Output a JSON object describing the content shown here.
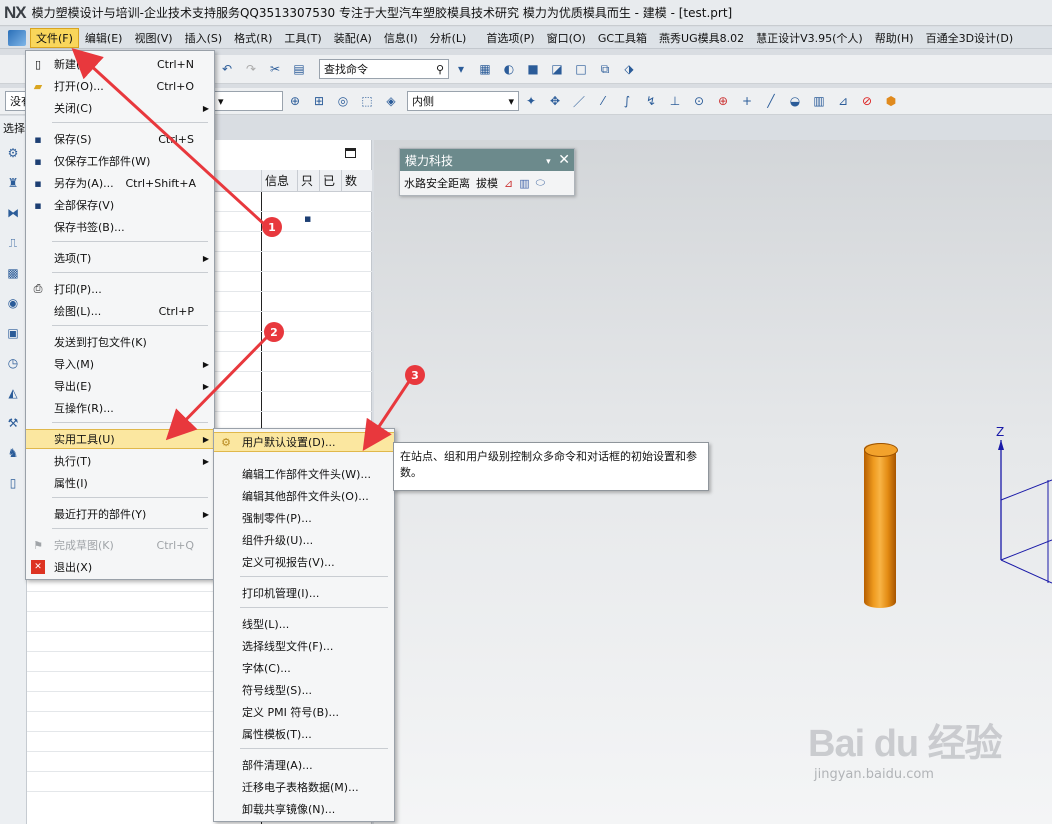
{
  "window": {
    "logo": "NX",
    "title": "模力塑模设计与培训-企业技术支持服务QQ3513307530  专注于大型汽车塑胶模具技术研究  模力为优质模具而生 - 建模 - [test.prt]"
  },
  "menubar": {
    "items": [
      "文件(F)",
      "编辑(E)",
      "视图(V)",
      "插入(S)",
      "格式(R)",
      "工具(T)",
      "装配(A)",
      "信息(I)",
      "分析(L)",
      "首选项(P)",
      "窗口(O)",
      "GC工具箱",
      "燕秀UG模具8.02",
      "慧正设计V3.95(个人)",
      "帮助(H)",
      "百通全3D设计(D)"
    ]
  },
  "toolbar": {
    "search_placeholder": "查找命令",
    "filter_prefix": "没有",
    "select_label": "选择",
    "inside_select": "内侧"
  },
  "navigator": {
    "columns": [
      "信息",
      "只",
      "已",
      "数"
    ]
  },
  "float_panel": {
    "title": "模力科技",
    "items": [
      "水路安全距离",
      "拔模"
    ]
  },
  "file_menu": {
    "new": {
      "label": "新建(N)",
      "shortcut": "Ctrl+N"
    },
    "open": {
      "label": "打开(O)...",
      "shortcut": "Ctrl+O"
    },
    "close": {
      "label": "关闭(C)"
    },
    "save": {
      "label": "保存(S)",
      "shortcut": "Ctrl+S"
    },
    "save_work_only": {
      "label": "仅保存工作部件(W)"
    },
    "save_as": {
      "label": "另存为(A)...",
      "shortcut": "Ctrl+Shift+A"
    },
    "save_all": {
      "label": "全部保存(V)"
    },
    "save_bookmark": {
      "label": "保存书签(B)..."
    },
    "options": {
      "label": "选项(T)"
    },
    "print": {
      "label": "打印(P)..."
    },
    "plot": {
      "label": "绘图(L)...",
      "shortcut": "Ctrl+P"
    },
    "send_to_package": {
      "label": "发送到打包文件(K)"
    },
    "import": {
      "label": "导入(M)"
    },
    "export": {
      "label": "导出(E)"
    },
    "interop": {
      "label": "互操作(R)..."
    },
    "utilities": {
      "label": "实用工具(U)"
    },
    "execute": {
      "label": "执行(T)"
    },
    "properties": {
      "label": "属性(I)"
    },
    "recent": {
      "label": "最近打开的部件(Y)"
    },
    "finish_sketch": {
      "label": "完成草图(K)",
      "shortcut": "Ctrl+Q"
    },
    "exit": {
      "label": "退出(X)"
    }
  },
  "utilities_menu": {
    "items": [
      "用户默认设置(D)...",
      "编辑工作部件文件头(W)...",
      "编辑其他部件文件头(O)...",
      "强制零件(P)...",
      "组件升级(U)...",
      "定义可视报告(V)...",
      "打印机管理(I)...",
      "线型(L)...",
      "选择线型文件(F)...",
      "字体(C)...",
      "符号线型(S)...",
      "定义 PMI 符号(B)...",
      "属性模板(T)...",
      "部件清理(A)...",
      "迁移电子表格数据(M)...",
      "卸载共享镜像(N)..."
    ]
  },
  "tooltip": {
    "text": "在站点、组和用户级别控制众多命令和对话框的初始设置和参数。"
  },
  "annotations": {
    "markers": [
      "1",
      "2",
      "3"
    ],
    "arrow_color": "#e8383d"
  },
  "axis": {
    "z_label": "Z"
  },
  "watermark": {
    "logo": "Bai du 经验",
    "url": "jingyan.baidu.com"
  }
}
